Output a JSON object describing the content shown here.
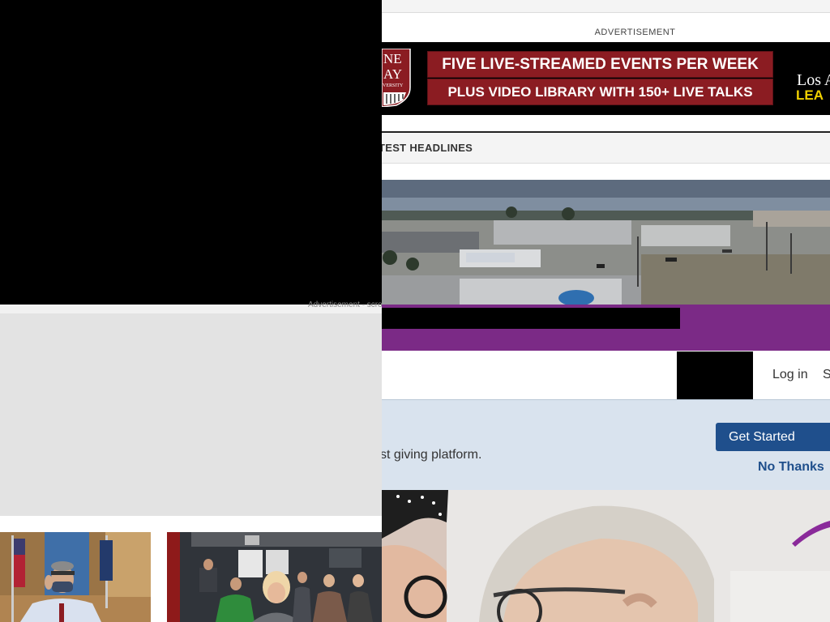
{
  "left_window": {
    "ad_caption": "Advertisement - scro"
  },
  "right_window": {
    "ad_label": "ADVERTISEMENT",
    "banner_ad": {
      "shield_text_1": "NE",
      "shield_text_2": "AY",
      "shield_text_3": "VERSITY",
      "line1": "FIVE LIVE-STREAMED EVENTS PER WEEK",
      "line2": "PLUS VIDEO LIBRARY WITH 150+ LIVE TALKS",
      "partner_logo": "Los A",
      "cta": "LEA"
    },
    "headlines_label": "TEST HEADLINES",
    "nav": {
      "login": "Log in",
      "signup": "S"
    },
    "promo": {
      "text": "st giving platform.",
      "primary_button": "Get Started",
      "secondary_link": "No Thanks"
    },
    "colors": {
      "accent_blue": "#1f4f8c",
      "ad_red": "#8b1c22",
      "brand_purple": "#7b2a86",
      "promo_bg": "#d9e3ee",
      "ad_gold": "#f0d000"
    }
  }
}
